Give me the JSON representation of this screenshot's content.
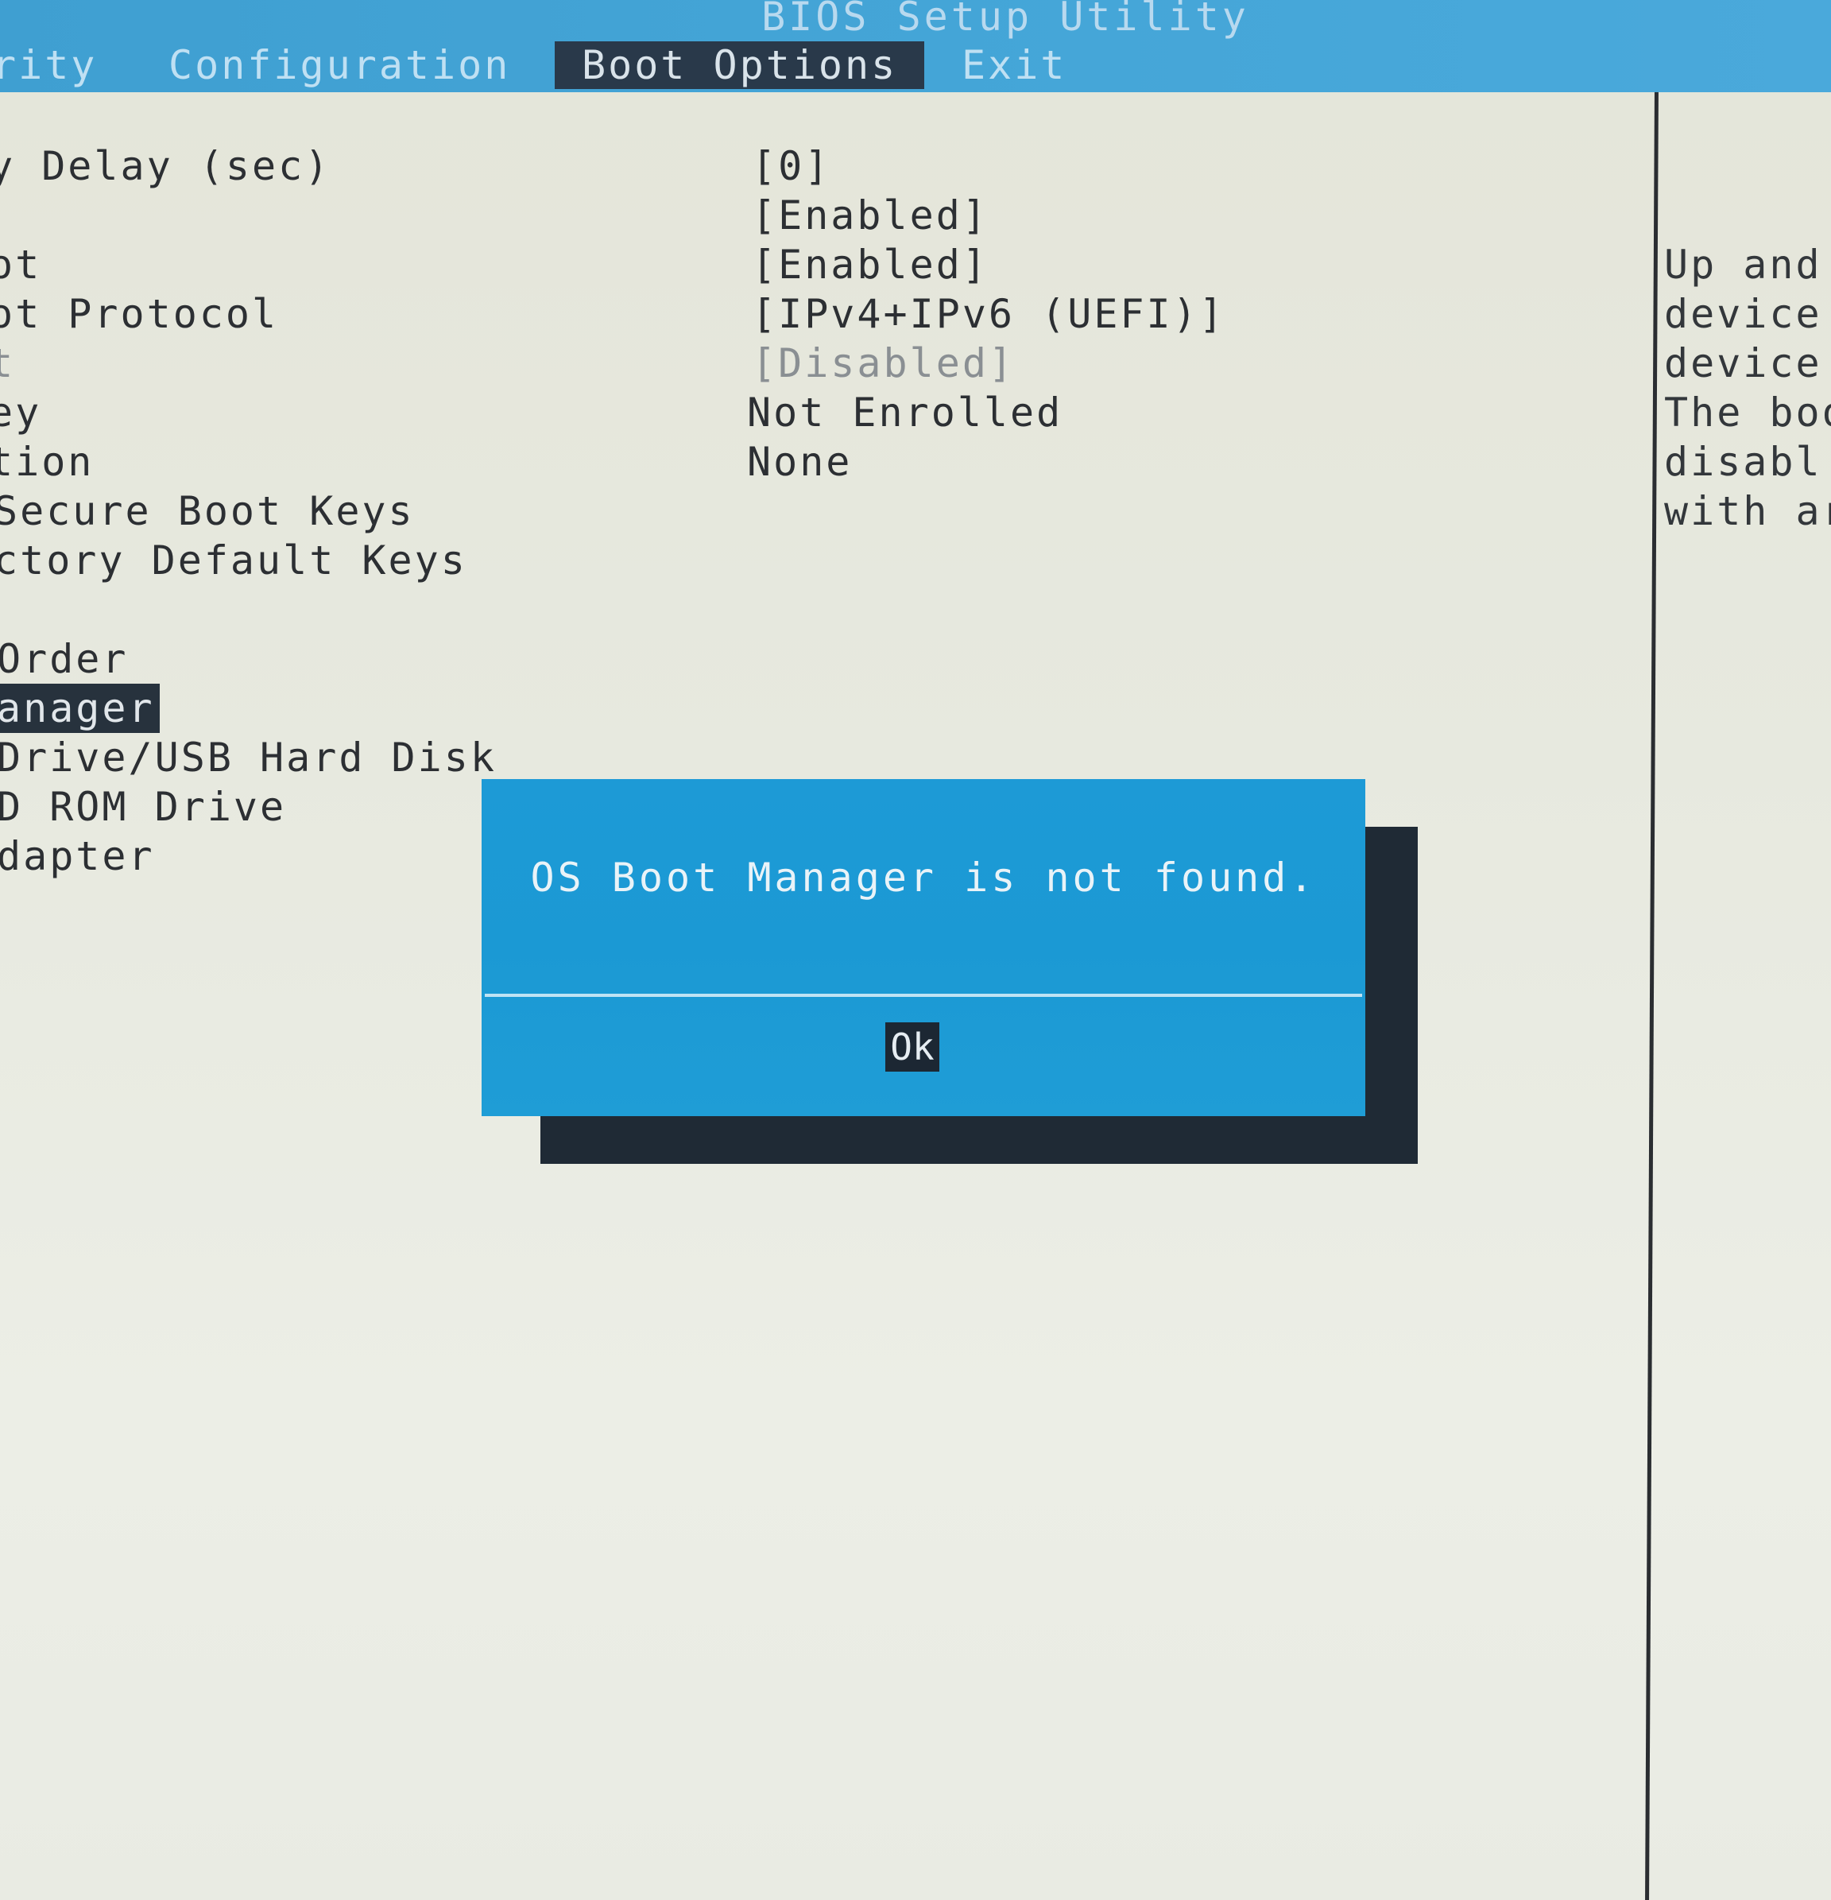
{
  "header": {
    "title": "BIOS Setup Utility",
    "tabs": [
      {
        "label": "rity"
      },
      {
        "label": "Configuration"
      },
      {
        "label": "Boot Options"
      },
      {
        "label": "Exit"
      }
    ]
  },
  "menu": {
    "rows": [
      {
        "label": "y Delay (sec)",
        "value": "[0]"
      },
      {
        "label": "",
        "value": "[Enabled]"
      },
      {
        "label": "ot",
        "value": "[Enabled]"
      },
      {
        "label": "ot Protocol",
        "value": "[IPv4+IPv6 (UEFI)]"
      },
      {
        "label": "t",
        "value": "[Disabled]"
      },
      {
        "label": "ey",
        "value": "Not Enrolled"
      },
      {
        "label": "tion",
        "value": "None"
      },
      {
        "label": "Secure Boot Keys",
        "value": ""
      },
      {
        "label": "ctory Default Keys",
        "value": ""
      },
      {
        "label": "Order",
        "value": ""
      },
      {
        "label": "anager",
        "value": ""
      },
      {
        "label": " Drive/USB Hard Disk",
        "value": ""
      },
      {
        "label": "D ROM Drive",
        "value": ""
      },
      {
        "label": "dapter",
        "value": ""
      }
    ]
  },
  "help": {
    "lines": [
      "Up and",
      "device",
      "device",
      "The boo",
      "disabl",
      "with ar"
    ]
  },
  "dialog": {
    "message": "OS Boot Manager is not found.",
    "ok_label": "Ok"
  },
  "colors": {
    "header": "#45a6d8",
    "dialog": "#1d9ad6",
    "selection": "#27323d",
    "background": "#e6e7dc"
  }
}
